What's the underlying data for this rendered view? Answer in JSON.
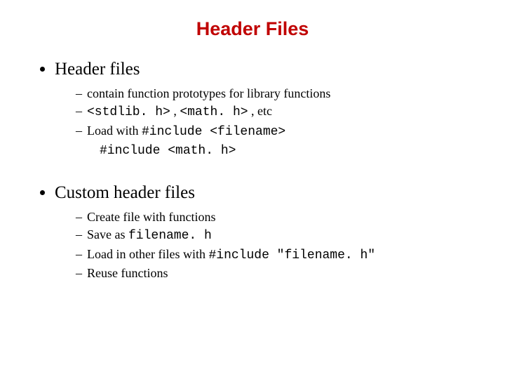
{
  "title": "Header Files",
  "section1": {
    "heading": "Header files",
    "items": {
      "i0": {
        "text": "contain function prototypes for library functions"
      },
      "i1": {
        "c1": "<stdlib. h>",
        "t1": " , ",
        "c2": "<math. h>",
        "t2": " , etc"
      },
      "i2": {
        "t1": "Load with ",
        "c1": "#include <filename>"
      },
      "indent": {
        "c1": "#include <math. h>"
      }
    }
  },
  "section2": {
    "heading": "Custom header files",
    "items": {
      "i0": {
        "text": "Create file with functions"
      },
      "i1": {
        "t1": "Save as ",
        "c1": "filename. h"
      },
      "i2": {
        "t1": "Load in other files with ",
        "c1": "#include \"filename. h\""
      },
      "i3": {
        "text": "Reuse functions"
      }
    }
  }
}
